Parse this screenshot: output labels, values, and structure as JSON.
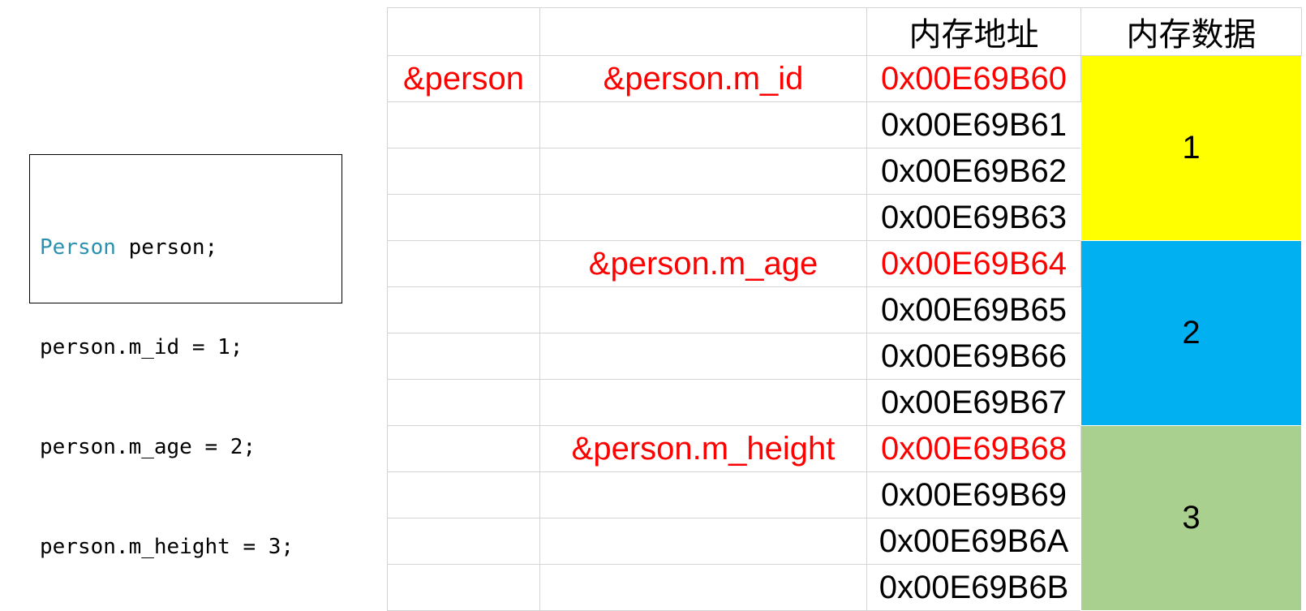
{
  "code": {
    "lines": [
      {
        "type": "Person",
        "rest": " person;"
      },
      {
        "type": "",
        "rest": "person.m_id = 1;"
      },
      {
        "type": "",
        "rest": "person.m_age = 2;"
      },
      {
        "type": "",
        "rest": "person.m_height = 3;"
      }
    ]
  },
  "table": {
    "headers": [
      "",
      "",
      "内存地址",
      "内存数据"
    ],
    "struct_label": "&person",
    "fields": [
      {
        "label": "&person.m_id",
        "value": "1",
        "color": "#ffff00"
      },
      {
        "label": "&person.m_age",
        "value": "2",
        "color": "#00b0f0"
      },
      {
        "label": "&person.m_height",
        "value": "3",
        "color": "#a9d08e"
      }
    ],
    "addresses": [
      "0x00E69B60",
      "0x00E69B61",
      "0x00E69B62",
      "0x00E69B63",
      "0x00E69B64",
      "0x00E69B65",
      "0x00E69B66",
      "0x00E69B67",
      "0x00E69B68",
      "0x00E69B69",
      "0x00E69B6A",
      "0x00E69B6B"
    ],
    "highlight_color": "#ff0000"
  }
}
